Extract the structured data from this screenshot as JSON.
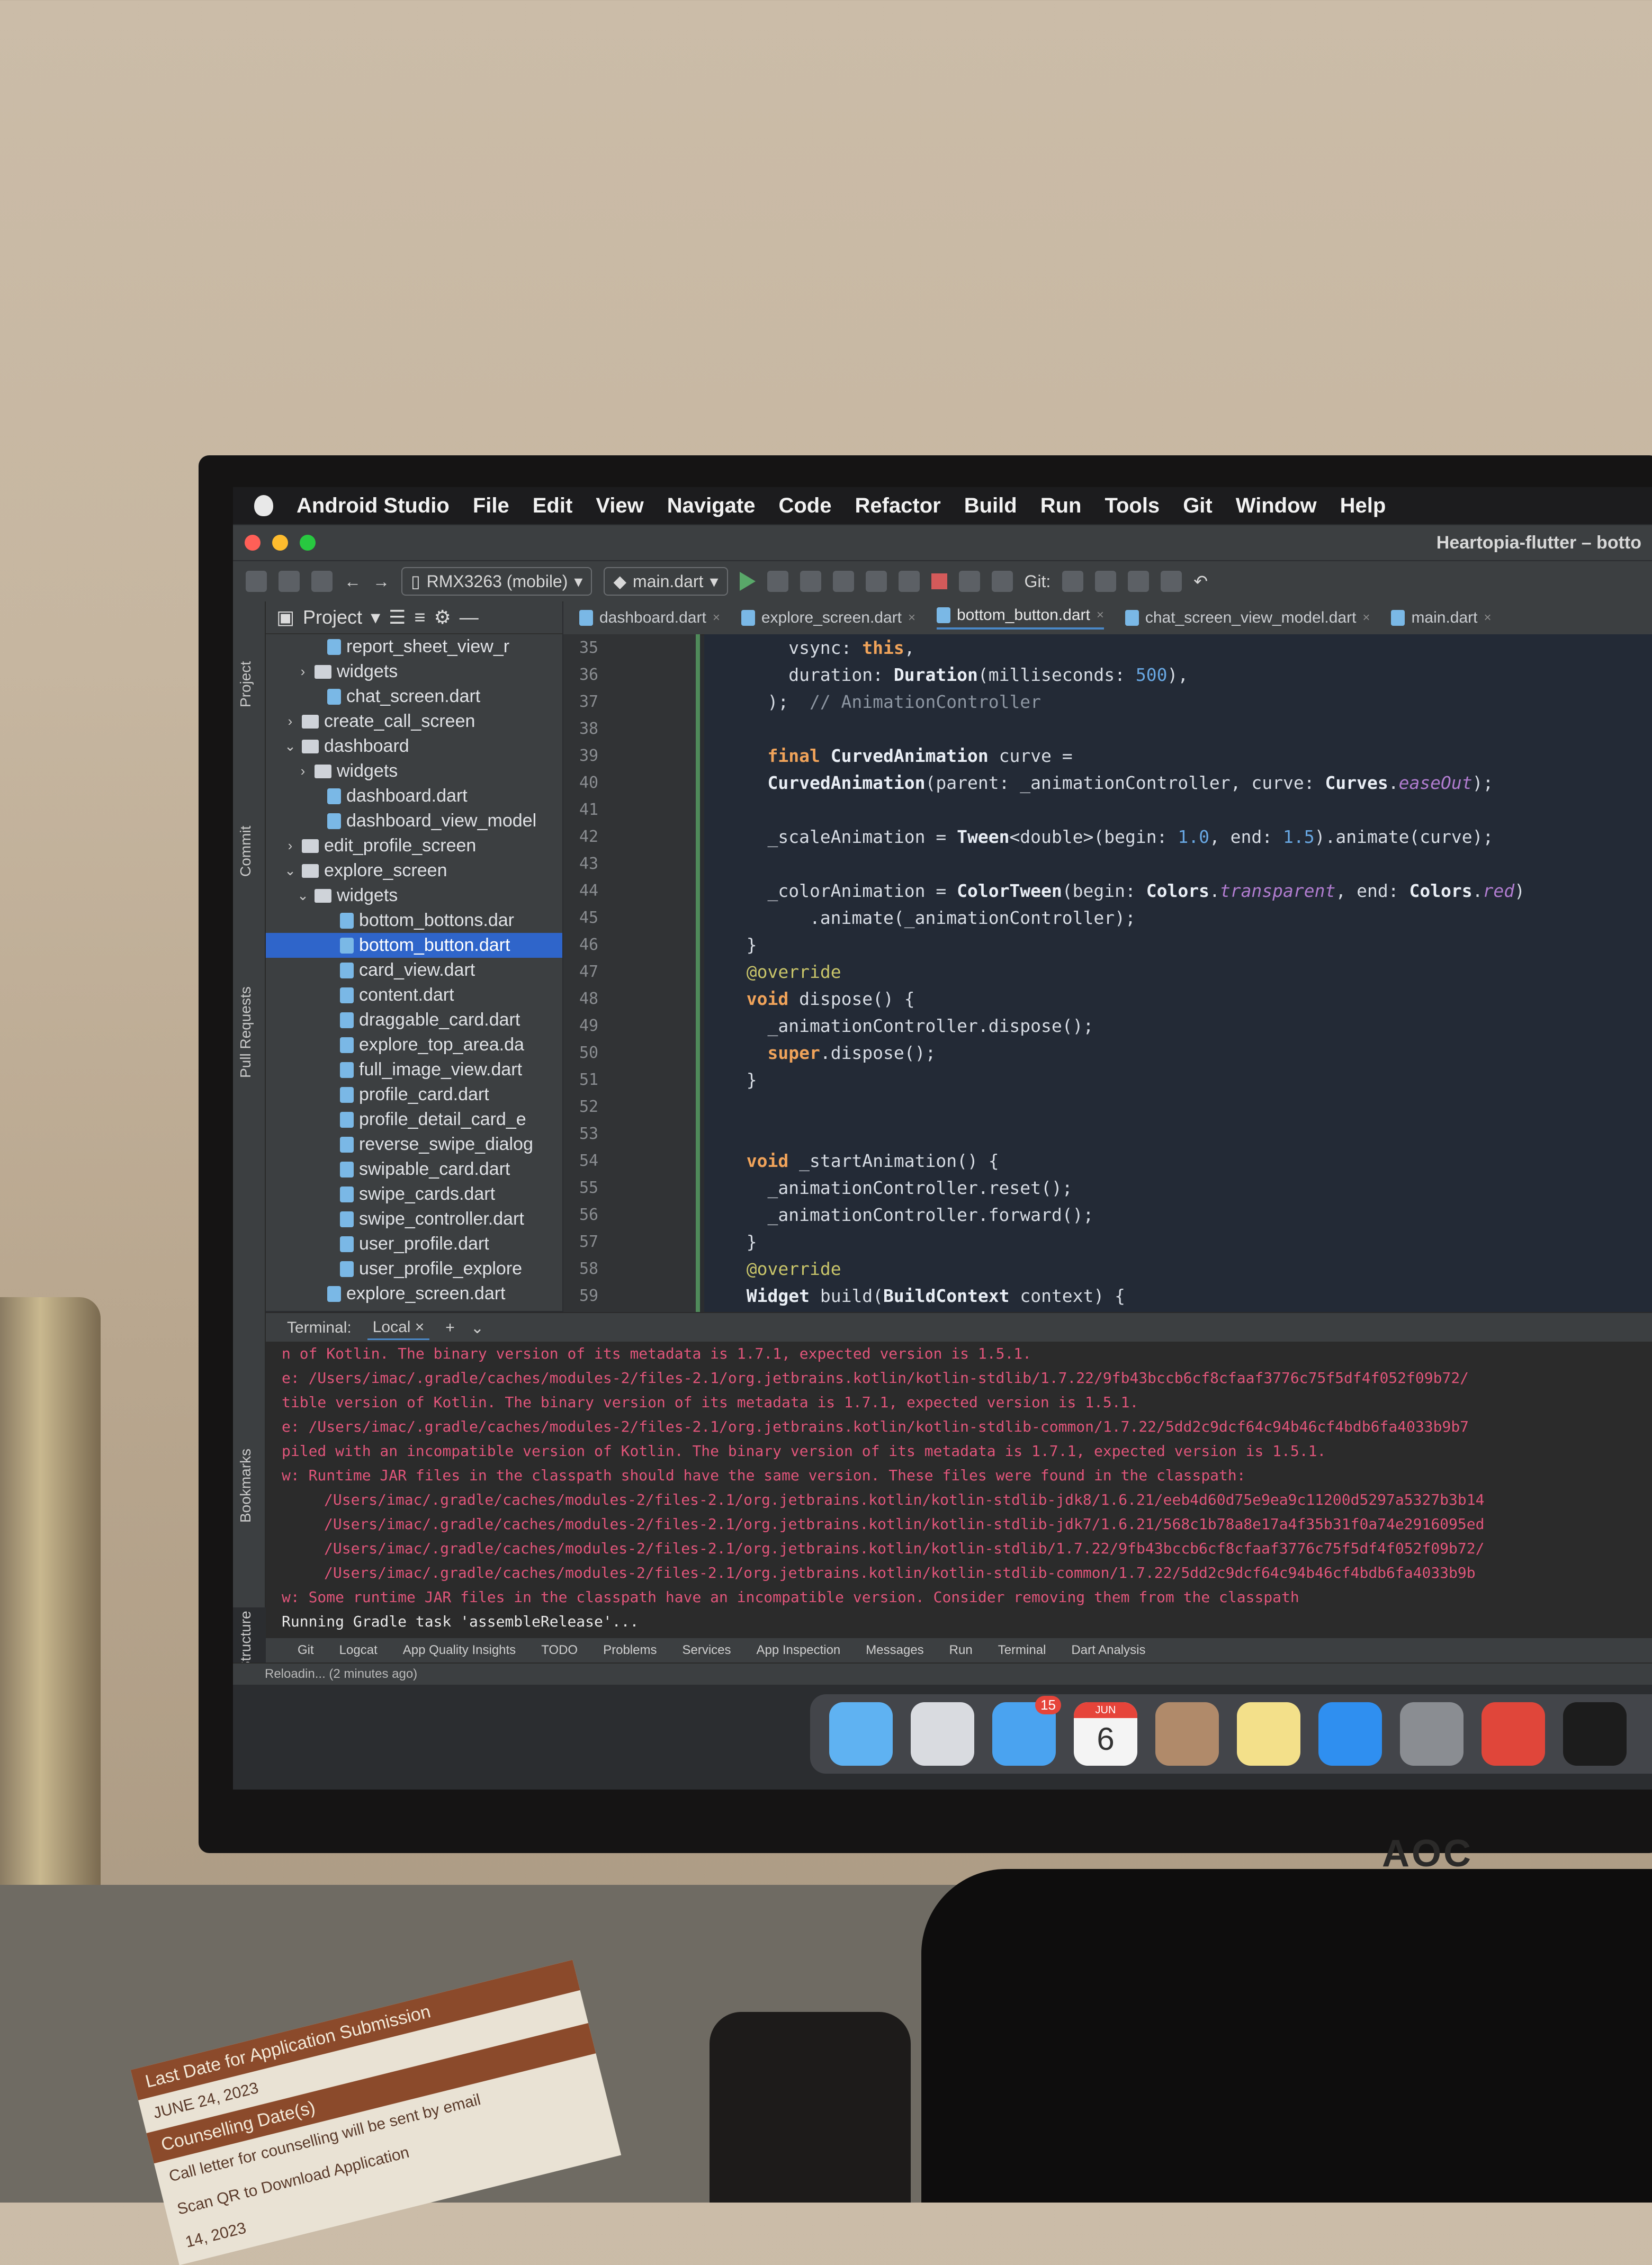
{
  "menubar": {
    "items": [
      "Android Studio",
      "File",
      "Edit",
      "View",
      "Navigate",
      "Code",
      "Refactor",
      "Build",
      "Run",
      "Tools",
      "Git",
      "Window",
      "Help"
    ]
  },
  "window": {
    "title": "Heartopia-flutter – botto"
  },
  "toolbar": {
    "device": "RMX3263 (mobile)",
    "config": "main.dart",
    "git_label": "Git:"
  },
  "project": {
    "title": "Project",
    "tree": [
      {
        "label": "report_sheet_view_r",
        "type": "dart",
        "indent": 3
      },
      {
        "label": "widgets",
        "type": "folder",
        "indent": 2,
        "arrow": "›"
      },
      {
        "label": "chat_screen.dart",
        "type": "dart",
        "indent": 3
      },
      {
        "label": "create_call_screen",
        "type": "folder",
        "indent": 1,
        "arrow": "›"
      },
      {
        "label": "dashboard",
        "type": "folder",
        "indent": 1,
        "arrow": "⌄"
      },
      {
        "label": "widgets",
        "type": "folder",
        "indent": 2,
        "arrow": "›"
      },
      {
        "label": "dashboard.dart",
        "type": "dart",
        "indent": 3
      },
      {
        "label": "dashboard_view_model",
        "type": "dart",
        "indent": 3
      },
      {
        "label": "edit_profile_screen",
        "type": "folder",
        "indent": 1,
        "arrow": "›"
      },
      {
        "label": "explore_screen",
        "type": "folder",
        "indent": 1,
        "arrow": "⌄"
      },
      {
        "label": "widgets",
        "type": "folder",
        "indent": 2,
        "arrow": "⌄"
      },
      {
        "label": "bottom_bottons.dar",
        "type": "dart",
        "indent": 4
      },
      {
        "label": "bottom_button.dart",
        "type": "dart",
        "indent": 4,
        "selected": true
      },
      {
        "label": "card_view.dart",
        "type": "dart",
        "indent": 4
      },
      {
        "label": "content.dart",
        "type": "dart",
        "indent": 4
      },
      {
        "label": "draggable_card.dart",
        "type": "dart",
        "indent": 4
      },
      {
        "label": "explore_top_area.da",
        "type": "dart",
        "indent": 4
      },
      {
        "label": "full_image_view.dart",
        "type": "dart",
        "indent": 4
      },
      {
        "label": "profile_card.dart",
        "type": "dart",
        "indent": 4
      },
      {
        "label": "profile_detail_card_e",
        "type": "dart",
        "indent": 4
      },
      {
        "label": "reverse_swipe_dialog",
        "type": "dart",
        "indent": 4
      },
      {
        "label": "swipable_card.dart",
        "type": "dart",
        "indent": 4
      },
      {
        "label": "swipe_cards.dart",
        "type": "dart",
        "indent": 4
      },
      {
        "label": "swipe_controller.dart",
        "type": "dart",
        "indent": 4
      },
      {
        "label": "user_profile.dart",
        "type": "dart",
        "indent": 4
      },
      {
        "label": "user_profile_explore",
        "type": "dart",
        "indent": 4
      },
      {
        "label": "explore_screen.dart",
        "type": "dart",
        "indent": 3
      }
    ]
  },
  "tool_strip": {
    "project": "Project",
    "commit": "Commit",
    "pull": "Pull Requests",
    "bookmarks": "Bookmarks",
    "structure": "Structure"
  },
  "tabs": [
    {
      "label": "dashboard.dart"
    },
    {
      "label": "explore_screen.dart"
    },
    {
      "label": "bottom_button.dart",
      "active": true
    },
    {
      "label": "chat_screen_view_model.dart"
    },
    {
      "label": "main.dart"
    }
  ],
  "editor": {
    "line_numbers": [
      "35",
      "36",
      "37",
      "38",
      "39",
      "40",
      "41",
      "42",
      "43",
      "44",
      "45",
      "46",
      "47",
      "48",
      "49",
      "50",
      "51",
      "52",
      "53",
      "54",
      "55",
      "56",
      "57",
      "58",
      "59"
    ],
    "lines": [
      "      vsync: this,",
      "      duration: Duration(milliseconds: 500),",
      "    );  // AnimationController",
      "",
      "    final CurvedAnimation curve =",
      "    CurvedAnimation(parent: _animationController, curve: Curves.easeOut);",
      "",
      "    _scaleAnimation = Tween<double>(begin: 1.0, end: 1.5).animate(curve);",
      "",
      "    _colorAnimation = ColorTween(begin: Colors.transparent, end: Colors.red)",
      "        .animate(_animationController);",
      "  }",
      "  @override",
      "  void dispose() {",
      "    _animationController.dispose();",
      "    super.dispose();",
      "  }",
      "",
      "",
      "  void _startAnimation() {",
      "    _animationController.reset();",
      "    _animationController.forward();",
      "  }",
      "  @override",
      "  Widget build(BuildContext context) {"
    ]
  },
  "terminal": {
    "label": "Terminal:",
    "tab": "Local",
    "lines": [
      {
        "text": "n of Kotlin. The binary version of its metadata is 1.7.1, expected version is 1.5.1."
      },
      {
        "text": "e: /Users/imac/.gradle/caches/modules-2/files-2.1/org.jetbrains.kotlin/kotlin-stdlib/1.7.22/9fb43bccb6cf8cfaaf3776c75f5df4f052f09b72/"
      },
      {
        "text": "tible version of Kotlin. The binary version of its metadata is 1.7.1, expected version is 1.5.1."
      },
      {
        "text": "e: /Users/imac/.gradle/caches/modules-2/files-2.1/org.jetbrains.kotlin/kotlin-stdlib-common/1.7.22/5dd2c9dcf64c94b46cf4bdb6fa4033b9b7"
      },
      {
        "text": "piled with an incompatible version of Kotlin. The binary version of its metadata is 1.7.1, expected version is 1.5.1."
      },
      {
        "text": "w: Runtime JAR files in the classpath should have the same version. These files were found in the classpath:"
      },
      {
        "text": "/Users/imac/.gradle/caches/modules-2/files-2.1/org.jetbrains.kotlin/kotlin-stdlib-jdk8/1.6.21/eeb4d60d75e9ea9c11200d5297a5327b3b14",
        "indent": true
      },
      {
        "text": "/Users/imac/.gradle/caches/modules-2/files-2.1/org.jetbrains.kotlin/kotlin-stdlib-jdk7/1.6.21/568c1b78a8e17a4f35b31f0a74e2916095ed",
        "indent": true
      },
      {
        "text": "/Users/imac/.gradle/caches/modules-2/files-2.1/org.jetbrains.kotlin/kotlin-stdlib/1.7.22/9fb43bccb6cf8cfaaf3776c75f5df4f052f09b72/",
        "indent": true
      },
      {
        "text": "/Users/imac/.gradle/caches/modules-2/files-2.1/org.jetbrains.kotlin/kotlin-stdlib-common/1.7.22/5dd2c9dcf64c94b46cf4bdb6fa4033b9b",
        "indent": true
      },
      {
        "text": "w: Some runtime JAR files in the classpath have an incompatible version. Consider removing them from the classpath"
      },
      {
        "text": "Running Gradle task 'assembleRelease'...",
        "ok": true
      }
    ]
  },
  "tool_windows": [
    "Git",
    "Logcat",
    "App Quality Insights",
    "TODO",
    "Problems",
    "Services",
    "App Inspection",
    "Messages",
    "Run",
    "Terminal",
    "Dart Analysis"
  ],
  "status": {
    "text": "Reloadin... (2 minutes ago)"
  },
  "dock": {
    "mail_badge": "15",
    "calendar_month": "JUN",
    "calendar_day": "6",
    "apps": [
      {
        "name": "finder-icon",
        "color": "#5fb2f2"
      },
      {
        "name": "launchpad-icon",
        "color": "#d9dbe0"
      },
      {
        "name": "mail-icon",
        "color": "#4aa3f0"
      },
      {
        "name": "calendar-icon",
        "color": "#f4f4f4"
      },
      {
        "name": "contacts-icon",
        "color": "#b08a6a"
      },
      {
        "name": "notes-icon",
        "color": "#f3e08a"
      },
      {
        "name": "app-store-icon",
        "color": "#2f8ff0"
      },
      {
        "name": "system-preferences-icon",
        "color": "#8a8d92"
      },
      {
        "name": "chrome-icon",
        "color": "#e0463a"
      },
      {
        "name": "terminal-icon",
        "color": "#1c1c1c"
      }
    ]
  },
  "monitor": {
    "brand": "AOC"
  },
  "paper": {
    "band1": "Last Date for Application Submission",
    "date1": "JUNE 24, 2023",
    "band2": "Counselling Date(s)",
    "text2": "Call letter for counselling will be sent by email",
    "text3": "Scan QR to Download Application",
    "date2": "14, 2023"
  }
}
